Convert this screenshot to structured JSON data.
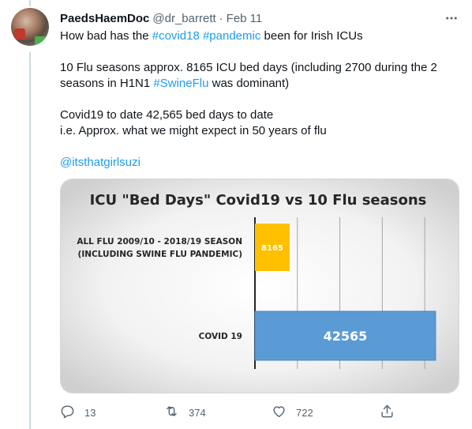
{
  "tweet": {
    "display_name": "PaedsHaemDoc",
    "handle": "@dr_barrett",
    "separator": "·",
    "date": "Feb 11",
    "line1_pre": "How bad has the ",
    "hashtag_covid18": "#covid18",
    "hashtag_pandemic": "#pandemic",
    "line1_post": " been for Irish ICUs",
    "line2": "10 Flu seasons approx. 8165 ICU bed days (including 2700 during the 2",
    "line3_pre": "seasons in H1N1 ",
    "hashtag_swineflu": "#SwineFlu",
    "line3_post": " was dominant)",
    "line4": "Covid19 to date 42,565 bed days to date",
    "line5": "i.e. Approx. what we might expect in 50 years of flu",
    "mention": "@itsthatgirlsuzi"
  },
  "actions": {
    "reply_count": "13",
    "retweet_count": "374",
    "like_count": "722"
  },
  "icons": {
    "more": "more-icon",
    "reply": "reply-icon",
    "retweet": "retweet-icon",
    "like": "like-icon",
    "share": "share-icon"
  },
  "colors": {
    "link": "#1d9bf0",
    "flu_bar": "#ffc000",
    "covid_bar": "#5b9bd5",
    "muted": "#536471"
  },
  "chart_data": {
    "type": "bar",
    "orientation": "horizontal",
    "title": "ICU \"Bed Days\"  Covid19 vs 10 Flu seasons",
    "categories": [
      [
        "ALL FLU 2009/10 - 2018/19 SEASON",
        "(INCLUDING SWINE FLU PANDEMIC)"
      ],
      [
        "COVID 19"
      ]
    ],
    "values": [
      8165,
      42565
    ],
    "value_labels": [
      "8165",
      "42565"
    ],
    "bar_colors": [
      "#ffc000",
      "#5b9bd5"
    ],
    "xlim": [
      0,
      45000
    ],
    "grid": true
  }
}
